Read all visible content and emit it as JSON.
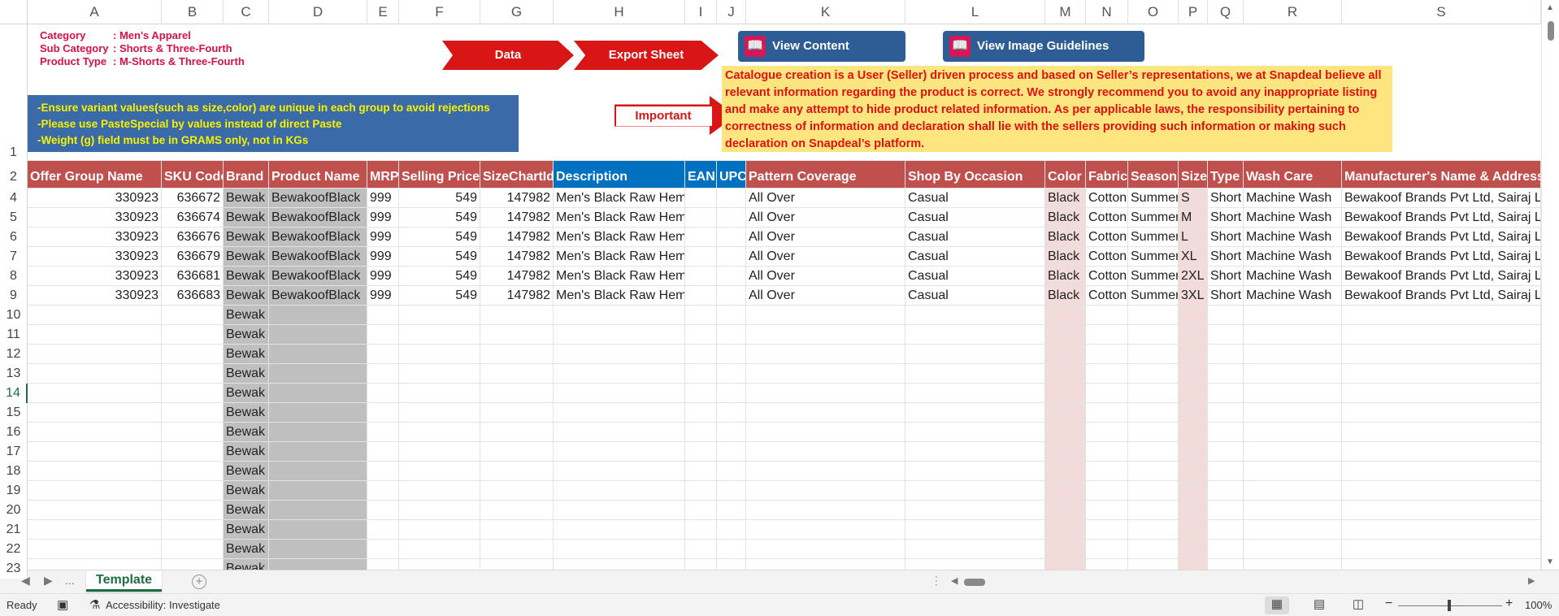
{
  "columns": [
    "A",
    "B",
    "C",
    "D",
    "E",
    "F",
    "G",
    "H",
    "I",
    "J",
    "K",
    "L",
    "M",
    "N",
    "O",
    "P",
    "Q",
    "R",
    "S"
  ],
  "banner": {
    "category_label": "Category",
    "category_value": ": Men's Apparel",
    "subcategory_label": "Sub Category",
    "subcategory_value": ": Shorts & Three-Fourth",
    "product_type_label": "Product Type",
    "product_type_value": ": M-Shorts & Three-Fourth",
    "data_button": "Data",
    "export_button": "Export Sheet",
    "content_guidelines_button": "View Content Guidelines",
    "image_guidelines_button": "View Image Guidelines",
    "notes": [
      "-Ensure variant values(such as size,color) are unique in each group to avoid rejections",
      "-Please use PasteSpecial by values instead of direct Paste",
      "-Weight (g) field must be in GRAMS only, not in KGs"
    ],
    "important_label": "Important",
    "disclaimer": "Catalogue creation is a User (Seller) driven process and based on Seller’s representations, we at Snapdeal believe all relevant information regarding the product is correct. We strongly recommend you to avoid any inappropriate listing and make any attempt to hide product related information. As per applicable laws, the responsibility pertaining to correctness of information and declaration shall lie with the sellers providing such information or making such declaration on Snapdeal’s platform."
  },
  "table": {
    "headers": [
      "Offer Group Name",
      "SKU Code",
      "Brand",
      "Product Name",
      "MRP",
      "Selling Price",
      "SizeChartId",
      "Description",
      "EAN",
      "UPC",
      "Pattern Coverage",
      "Shop By Occasion",
      "Color",
      "Fabric",
      "Season",
      "Size",
      "Type",
      "Wash Care",
      "Manufacturer's Name & Address"
    ],
    "rows": [
      [
        "330923",
        "636672",
        "Bewak",
        "BewakoofBlack",
        "999",
        "549",
        "147982",
        "Men's Black Raw Hem Shorts",
        "",
        "",
        "All Over",
        "Casual",
        "Black",
        "Cotton",
        "Summer",
        "S",
        "Short",
        "Machine Wash",
        "Bewakoof Brands Pvt Ltd, Sairaj L"
      ],
      [
        "330923",
        "636674",
        "Bewak",
        "BewakoofBlack",
        "999",
        "549",
        "147982",
        "Men's Black Raw Hem Shorts",
        "",
        "",
        "All Over",
        "Casual",
        "Black",
        "Cotton",
        "Summer",
        "M",
        "Short",
        "Machine Wash",
        "Bewakoof Brands Pvt Ltd, Sairaj L"
      ],
      [
        "330923",
        "636676",
        "Bewak",
        "BewakoofBlack",
        "999",
        "549",
        "147982",
        "Men's Black Raw Hem Shorts",
        "",
        "",
        "All Over",
        "Casual",
        "Black",
        "Cotton",
        "Summer",
        "L",
        "Short",
        "Machine Wash",
        "Bewakoof Brands Pvt Ltd, Sairaj L"
      ],
      [
        "330923",
        "636679",
        "Bewak",
        "BewakoofBlack",
        "999",
        "549",
        "147982",
        "Men's Black Raw Hem Shorts",
        "",
        "",
        "All Over",
        "Casual",
        "Black",
        "Cotton",
        "Summer",
        "XL",
        "Short",
        "Machine Wash",
        "Bewakoof Brands Pvt Ltd, Sairaj L"
      ],
      [
        "330923",
        "636681",
        "Bewak",
        "BewakoofBlack",
        "999",
        "549",
        "147982",
        "Men's Black Raw Hem Shorts",
        "",
        "",
        "All Over",
        "Casual",
        "Black",
        "Cotton",
        "Summer",
        "2XL",
        "Short",
        "Machine Wash",
        "Bewakoof Brands Pvt Ltd, Sairaj L"
      ],
      [
        "330923",
        "636683",
        "Bewak",
        "BewakoofBlack",
        "999",
        "549",
        "147982",
        "Men's Black Raw Hem Shorts",
        "",
        "",
        "All Over",
        "Casual",
        "Black",
        "Cotton",
        "Summer",
        "3XL",
        "Short",
        "Machine Wash",
        "Bewakoof Brands Pvt Ltd, Sairaj L"
      ]
    ],
    "empty_brand_value": "Bewak"
  },
  "row_numbers": [
    "1",
    "2",
    "4",
    "5",
    "6",
    "7",
    "8",
    "9",
    "10",
    "11",
    "12",
    "13",
    "14",
    "15",
    "16",
    "17",
    "18",
    "19",
    "20",
    "21",
    "22",
    "23"
  ],
  "tabs": {
    "sheet_name": "Template",
    "more": "...",
    "add": "+"
  },
  "status": {
    "ready": "Ready",
    "accessibility": "Accessibility: Investigate",
    "zoom": "100%"
  },
  "colors": {
    "header_red": "#c0504d",
    "header_blue": "#0070c0",
    "brand_red": "#d81616",
    "notes_blue": "#3a6aa8",
    "disclaimer_yellow": "#ffe57f",
    "excel_green": "#1e6c41"
  }
}
